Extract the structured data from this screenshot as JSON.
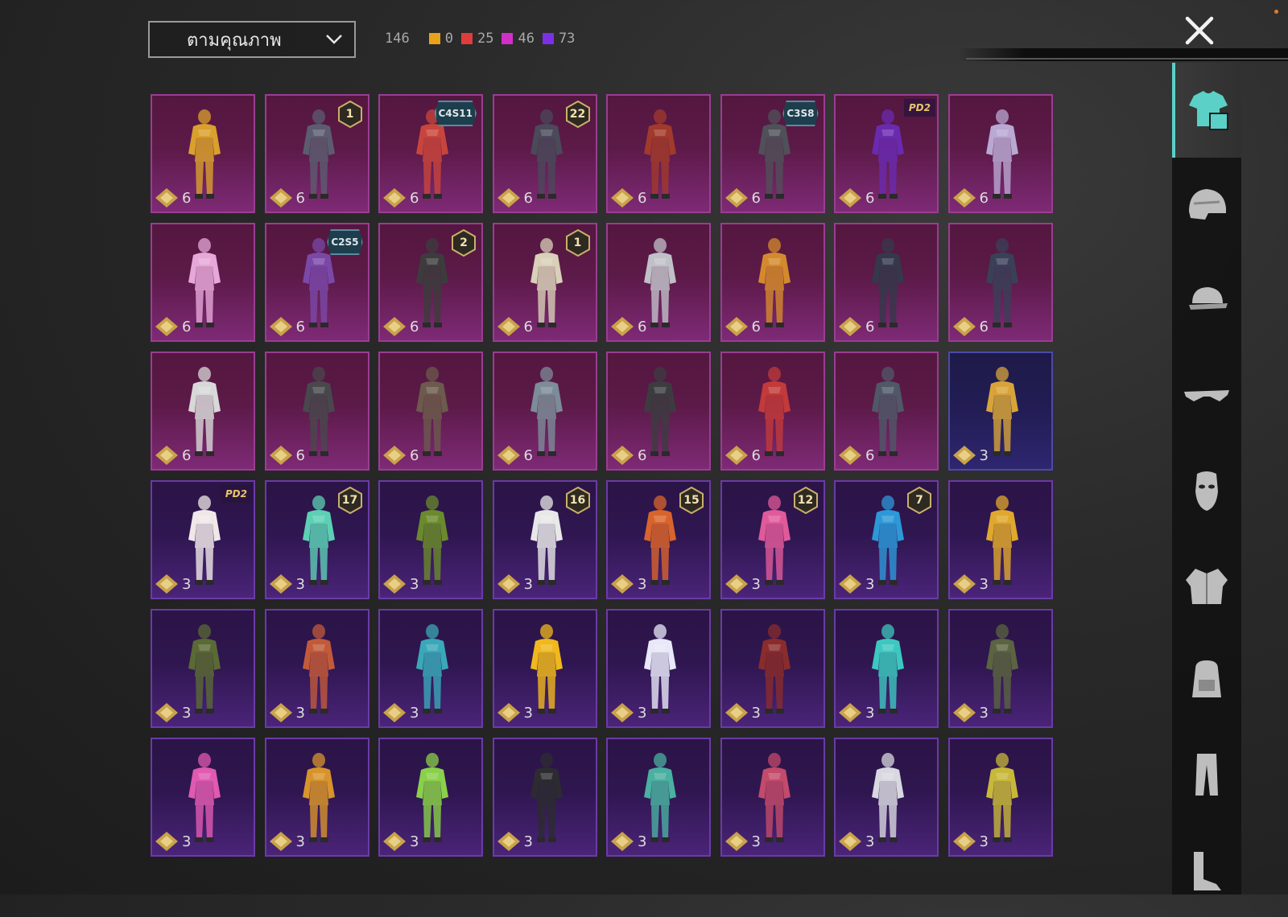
{
  "sort": {
    "label": "ตามคุณภาพ"
  },
  "counts": {
    "total": "146",
    "items": [
      {
        "color": "#e8a21c",
        "value": "0"
      },
      {
        "color": "#e03c3c",
        "value": "25"
      },
      {
        "color": "#d22ec8",
        "value": "46"
      },
      {
        "color": "#7b2fe6",
        "value": "73"
      }
    ]
  },
  "sidebar": {
    "items": [
      {
        "icon": "outfit-icon",
        "active": true
      },
      {
        "icon": "helmet-icon",
        "active": false
      },
      {
        "icon": "cap-icon",
        "active": false
      },
      {
        "icon": "glasses-icon",
        "active": false
      },
      {
        "icon": "mask-icon",
        "active": false
      },
      {
        "icon": "jacket-icon",
        "active": false
      },
      {
        "icon": "backpack-icon",
        "active": false
      },
      {
        "icon": "pants-icon",
        "active": false
      },
      {
        "icon": "shoes-icon",
        "active": false
      }
    ]
  },
  "cards": [
    {
      "price": "6",
      "quality": "pink",
      "badge": null,
      "color": "#d9a02c"
    },
    {
      "price": "6",
      "quality": "pink",
      "badge": "1",
      "color": "#5c5c70"
    },
    {
      "price": "6",
      "quality": "pink",
      "badge": "C4S11",
      "color": "#c8453c"
    },
    {
      "price": "6",
      "quality": "pink",
      "badge": "22",
      "color": "#4a4a5a"
    },
    {
      "price": "6",
      "quality": "pink",
      "badge": null,
      "color": "#a13a2c"
    },
    {
      "price": "6",
      "quality": "pink",
      "badge": "C3S8",
      "color": "#505058"
    },
    {
      "price": "6",
      "quality": "pink",
      "badge": "PD2",
      "color": "#6a2ab0"
    },
    {
      "price": "6",
      "quality": "pink",
      "badge": null,
      "color": "#b9a8d2"
    },
    {
      "price": "6",
      "quality": "pink",
      "badge": null,
      "color": "#e6a8d8"
    },
    {
      "price": "6",
      "quality": "pink",
      "badge": "C2S5",
      "color": "#7a48a8"
    },
    {
      "price": "6",
      "quality": "pink",
      "badge": "2",
      "color": "#3c3c3c"
    },
    {
      "price": "6",
      "quality": "pink",
      "badge": "1",
      "color": "#d8d0b8"
    },
    {
      "price": "6",
      "quality": "pink",
      "badge": null,
      "color": "#c0c0c8"
    },
    {
      "price": "6",
      "quality": "pink",
      "badge": null,
      "color": "#d48a2c"
    },
    {
      "price": "6",
      "quality": "pink",
      "badge": null,
      "color": "#34384a"
    },
    {
      "price": "6",
      "quality": "pink",
      "badge": null,
      "color": "#3a4058"
    },
    {
      "price": "6",
      "quality": "pink",
      "badge": null,
      "color": "#d8d8d8"
    },
    {
      "price": "6",
      "quality": "pink",
      "badge": null,
      "color": "#48484c"
    },
    {
      "price": "6",
      "quality": "pink",
      "badge": null,
      "color": "#6c5a4c"
    },
    {
      "price": "6",
      "quality": "pink",
      "badge": null,
      "color": "#7c8c98"
    },
    {
      "price": "6",
      "quality": "pink",
      "badge": null,
      "color": "#3c3c40"
    },
    {
      "price": "6",
      "quality": "pink",
      "badge": null,
      "color": "#c23a3a"
    },
    {
      "price": "6",
      "quality": "pink",
      "badge": null,
      "color": "#505868"
    },
    {
      "price": "3",
      "quality": "sel",
      "badge": null,
      "color": "#d8a43a"
    },
    {
      "price": "3",
      "quality": "purple",
      "badge": "PD2",
      "color": "#f0e8e8"
    },
    {
      "price": "3",
      "quality": "purple",
      "badge": "17",
      "color": "#5cd0b4"
    },
    {
      "price": "3",
      "quality": "purple",
      "badge": null,
      "color": "#6a8a2c"
    },
    {
      "price": "3",
      "quality": "purple",
      "badge": "16",
      "color": "#e8e8e8"
    },
    {
      "price": "3",
      "quality": "purple",
      "badge": "15",
      "color": "#d8642c"
    },
    {
      "price": "3",
      "quality": "purple",
      "badge": "12",
      "color": "#e05a9a"
    },
    {
      "price": "3",
      "quality": "purple",
      "badge": "7",
      "color": "#2c98d8"
    },
    {
      "price": "3",
      "quality": "purple",
      "badge": null,
      "color": "#e0a82c"
    },
    {
      "price": "3",
      "quality": "purple",
      "badge": null,
      "color": "#5a6a34"
    },
    {
      "price": "3",
      "quality": "purple",
      "badge": null,
      "color": "#c25a3a"
    },
    {
      "price": "3",
      "quality": "purple",
      "badge": null,
      "color": "#3aa8b8"
    },
    {
      "price": "3",
      "quality": "purple",
      "badge": null,
      "color": "#f0b81c"
    },
    {
      "price": "3",
      "quality": "purple",
      "badge": null,
      "color": "#e8e8f8"
    },
    {
      "price": "3",
      "quality": "purple",
      "badge": null,
      "color": "#8a2c2c"
    },
    {
      "price": "3",
      "quality": "purple",
      "badge": null,
      "color": "#3cc8c0"
    },
    {
      "price": "3",
      "quality": "purple",
      "badge": null,
      "color": "#5a6440"
    },
    {
      "price": "3",
      "quality": "purple",
      "badge": null,
      "color": "#e05ab0"
    },
    {
      "price": "3",
      "quality": "purple",
      "badge": null,
      "color": "#d8942c"
    },
    {
      "price": "3",
      "quality": "purple",
      "badge": null,
      "color": "#8ad04a"
    },
    {
      "price": "3",
      "quality": "purple",
      "badge": null,
      "color": "#2c2c30"
    },
    {
      "price": "3",
      "quality": "purple",
      "badge": null,
      "color": "#4ab0a0"
    },
    {
      "price": "3",
      "quality": "purple",
      "badge": null,
      "color": "#c24a6a"
    },
    {
      "price": "3",
      "quality": "purple",
      "badge": null,
      "color": "#d8d8e0"
    },
    {
      "price": "3",
      "quality": "purple",
      "badge": null,
      "color": "#c8b83a"
    }
  ]
}
